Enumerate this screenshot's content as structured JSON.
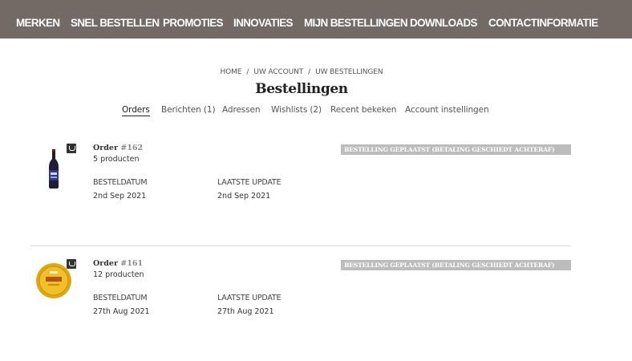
{
  "nav": {
    "items": [
      "MERKEN",
      "SNEL BESTELLEN",
      "PROMOTIES",
      "INNOVATIES",
      "MIJN BESTELLINGEN",
      "DOWNLOADS",
      "CONTACTINFORMATIE"
    ]
  },
  "breadcrumb": {
    "home": "HOME",
    "account": "UW ACCOUNT",
    "orders": "UW BESTELLINGEN",
    "separator": "/"
  },
  "page_title": "Bestellingen",
  "tabs": [
    "Orders",
    "Berichten (1)",
    "Adressen",
    "Wishlists (2)",
    "Recent bekeken",
    "Account instellingen"
  ],
  "active_tab": "Orders",
  "orders": [
    {
      "title_prefix": "Order ",
      "number": "#162",
      "product_count": "5 producten",
      "status": "BESTELLING GEPLAATST (BETALING GESCHIEDT ACHTERAF)",
      "date_label": "BESTELDATUM",
      "date_value": "2nd Sep 2021",
      "update_label": "LAATSTE UPDATE",
      "update_value": "2nd Sep 2021",
      "image_icon": "beer-bottle-icon"
    },
    {
      "title_prefix": "Order ",
      "number": "#161",
      "product_count": "12 producten",
      "status": "BESTELLING GEPLAATST (BETALING GESCHIEDT ACHTERAF)",
      "date_label": "BESTELDATUM",
      "date_value": "27th Aug 2021",
      "update_label": "LAATSTE UPDATE",
      "update_value": "27th Aug 2021",
      "image_icon": "gold-label-icon"
    }
  ],
  "colors": {
    "nav_bg": "#736a65",
    "status_bg": "#bcbcbc",
    "divider": "#dcdcdc"
  }
}
